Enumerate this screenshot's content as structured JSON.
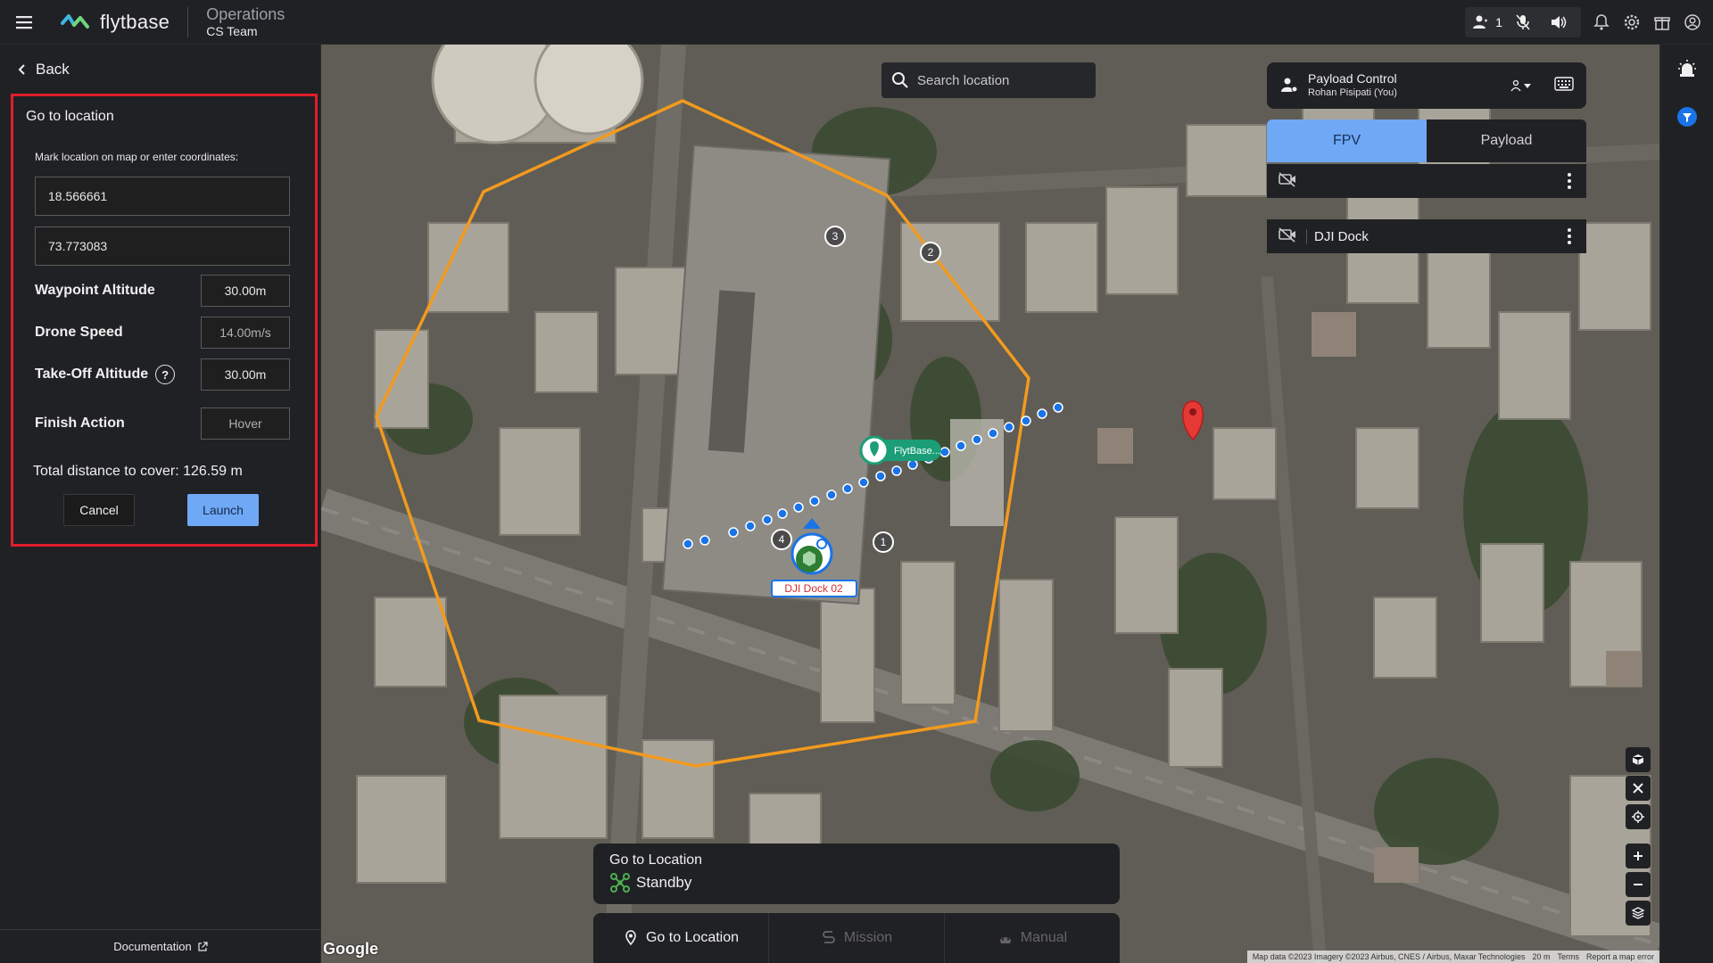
{
  "header": {
    "logo_text": "flytbase",
    "org_title": "Operations",
    "org_subtitle": "CS Team",
    "user_count": "1",
    "icons": [
      "users-icon",
      "mic-off-icon",
      "speaker-icon",
      "bell-icon",
      "gear-icon",
      "gift-icon",
      "account-icon"
    ]
  },
  "left_panel": {
    "back_label": "Back",
    "card": {
      "title": "Go to location",
      "hint": "Mark location on map or enter coordinates:",
      "latitude": "18.566661",
      "longitude": "73.773083",
      "waypoint_altitude": {
        "label": "Waypoint Altitude",
        "value": "30.00m"
      },
      "drone_speed": {
        "label": "Drone Speed",
        "value": "14.00m/s"
      },
      "takeoff_altitude": {
        "label": "Take-Off Altitude",
        "value": "30.00m"
      },
      "finish_action": {
        "label": "Finish Action",
        "value": "Hover"
      },
      "total_distance": "Total distance to cover: 126.59 m",
      "cancel_label": "Cancel",
      "launch_label": "Launch"
    },
    "documentation_label": "Documentation"
  },
  "map": {
    "search_placeholder": "Search location",
    "payload_control": {
      "title": "Payload Control",
      "subtitle": "Rohan Pisipati (You)"
    },
    "tabs": [
      {
        "label": "FPV",
        "active": true
      },
      {
        "label": "Payload",
        "active": false
      }
    ],
    "feeds": [
      {
        "label": ""
      },
      {
        "label": "DJI Dock"
      }
    ],
    "markers": {
      "dock_label": "FlytBase...",
      "drone_label": "DJI Dock 02",
      "waypoints": [
        "1",
        "2",
        "3",
        "4"
      ]
    },
    "status": {
      "title": "Go to Location",
      "state": "Standby"
    },
    "modes": [
      {
        "label": "Go to Location",
        "icon": "pin-icon",
        "enabled": true
      },
      {
        "label": "Mission",
        "icon": "route-icon",
        "enabled": false
      },
      {
        "label": "Manual",
        "icon": "joystick-icon",
        "enabled": false
      }
    ],
    "google_label": "Google",
    "attribution": [
      "Map data ©2023 Imagery ©2023 Airbus, CNES / Airbus, Maxar Technologies",
      "20 m",
      "Terms",
      "Report a map error"
    ],
    "colors": {
      "geofence": "#f29a1f",
      "path": "#1a73e8",
      "target": "#e53935",
      "accent": "#6fa8f5"
    }
  }
}
